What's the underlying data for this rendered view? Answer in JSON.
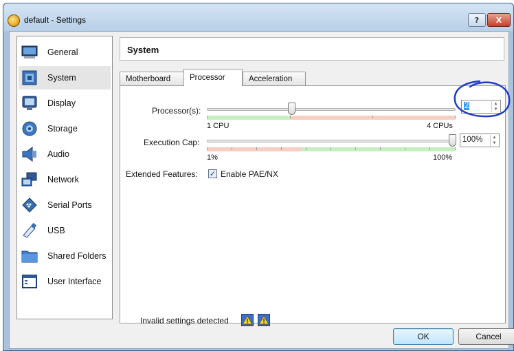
{
  "window": {
    "title": "default - Settings",
    "help_label": "?",
    "close_label": "X"
  },
  "sidebar": {
    "items": [
      {
        "label": "General",
        "icon": "monitor-icon"
      },
      {
        "label": "System",
        "icon": "chip-icon",
        "selected": true
      },
      {
        "label": "Display",
        "icon": "display-icon"
      },
      {
        "label": "Storage",
        "icon": "disk-icon"
      },
      {
        "label": "Audio",
        "icon": "speaker-icon"
      },
      {
        "label": "Network",
        "icon": "network-icon"
      },
      {
        "label": "Serial Ports",
        "icon": "serial-port-icon"
      },
      {
        "label": "USB",
        "icon": "usb-icon"
      },
      {
        "label": "Shared Folders",
        "icon": "folder-icon"
      },
      {
        "label": "User Interface",
        "icon": "window-icon"
      }
    ]
  },
  "section": {
    "title": "System"
  },
  "tabs": [
    {
      "label": "Motherboard"
    },
    {
      "label": "Processor",
      "active": true
    },
    {
      "label": "Acceleration"
    }
  ],
  "processor": {
    "processors_label": "Processor(s):",
    "processors_value": "2",
    "processors_min_label": "1 CPU",
    "processors_max_label": "4 CPUs",
    "exec_cap_label": "Execution Cap:",
    "exec_cap_value": "100%",
    "exec_cap_min_label": "1%",
    "exec_cap_max_label": "100%",
    "extended_features_label": "Extended Features:",
    "pae_label": "Enable PAE/NX",
    "pae_checked": true
  },
  "status": {
    "message": "Invalid settings detected"
  },
  "buttons": {
    "ok": "OK",
    "cancel": "Cancel"
  },
  "colors": {
    "valid_zone": "#c6efc0",
    "warn_zone": "#f7cfc2",
    "annotation": "#1e3cc8",
    "selection": "#3399ff"
  }
}
